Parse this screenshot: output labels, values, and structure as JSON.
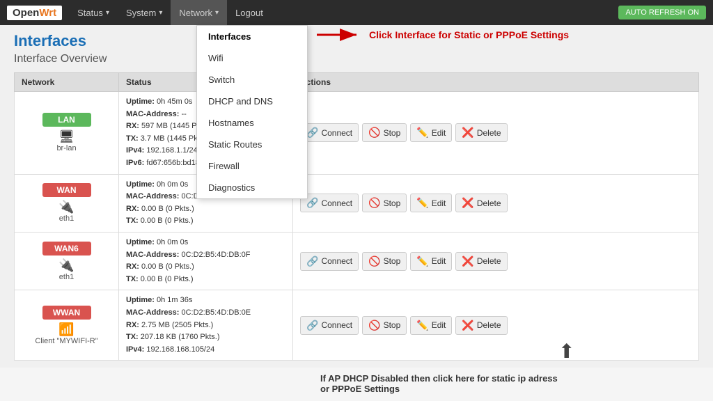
{
  "navbar": {
    "brand": "OpenWrt",
    "items": [
      {
        "label": "Status",
        "has_arrow": true
      },
      {
        "label": "System",
        "has_arrow": true
      },
      {
        "label": "Network",
        "has_arrow": true,
        "active": true
      },
      {
        "label": "Logout",
        "has_arrow": false
      }
    ],
    "auto_refresh_label": "AUTO REFRESH ON"
  },
  "dropdown": {
    "items": [
      {
        "label": "Interfaces",
        "active": true
      },
      {
        "label": "Wifi",
        "active": false
      },
      {
        "label": "Switch",
        "active": false
      },
      {
        "label": "DHCP and DNS",
        "active": false
      },
      {
        "label": "Hostnames",
        "active": false
      },
      {
        "label": "Static Routes",
        "active": false
      },
      {
        "label": "Firewall",
        "active": false
      },
      {
        "label": "Diagnostics",
        "active": false
      }
    ]
  },
  "annotation": {
    "header_text": "Click Interface for Static or PPPoE Settings",
    "bottom_text": "If AP DHCP Disabled then click here for static ip adress or PPPoE Settings"
  },
  "page": {
    "title": "Interfaces",
    "subtitle": "Interface Overview"
  },
  "table": {
    "headers": [
      "Network",
      "Status",
      "Actions"
    ],
    "rows": [
      {
        "name": "LAN",
        "badge_class": "green",
        "icon": "🖥",
        "device": "br-lan",
        "status": "Uptime: 0h 45m 0s\nMAC-Address: --\nRX: 597 MB (1445 Pkts.)\nTX: 3.7 MB (1445 Pkts.)\nIPv4: 192.168.1.1/24\nIPv6: fd67:656b:bd18::1/60",
        "status_lines": [
          {
            "bold": "Uptime:",
            "text": " 0h 45m 0s"
          },
          {
            "bold": "MAC-Address:",
            "text": " --"
          },
          {
            "bold": "RX:",
            "text": " 597 MB (1445 Pkts.)"
          },
          {
            "bold": "TX:",
            "text": " 3.7 MB (1445 Pkts.)"
          },
          {
            "bold": "IPv4:",
            "text": " 192.168.1.1/24"
          },
          {
            "bold": "IPv6:",
            "text": " fd67:656b:bd18::1/60"
          }
        ]
      },
      {
        "name": "WAN",
        "badge_class": "red",
        "icon": "🔌",
        "device": "eth1",
        "status_lines": [
          {
            "bold": "Uptime:",
            "text": " 0h 0m 0s"
          },
          {
            "bold": "MAC-Address:",
            "text": " 0C:D2:B5:4D:DB:0F"
          },
          {
            "bold": "RX:",
            "text": " 0.00 B (0 Pkts.)"
          },
          {
            "bold": "TX:",
            "text": " 0.00 B (0 Pkts.)"
          }
        ]
      },
      {
        "name": "WAN6",
        "badge_class": "red",
        "icon": "🔌",
        "device": "eth1",
        "status_lines": [
          {
            "bold": "Uptime:",
            "text": " 0h 0m 0s"
          },
          {
            "bold": "MAC-Address:",
            "text": " 0C:D2:B5:4D:DB:0F"
          },
          {
            "bold": "RX:",
            "text": " 0.00 B (0 Pkts.)"
          },
          {
            "bold": "TX:",
            "text": " 0.00 B (0 Pkts.)"
          }
        ]
      },
      {
        "name": "WWAN",
        "badge_class": "red",
        "icon": "📶",
        "device": "Client \"MYWIFI-R\"",
        "status_lines": [
          {
            "bold": "Uptime:",
            "text": " 0h 1m 36s"
          },
          {
            "bold": "MAC-Address:",
            "text": " 0C:D2:B5:4D:DB:0E"
          },
          {
            "bold": "RX:",
            "text": " 2.75 MB (2505 Pkts.)"
          },
          {
            "bold": "TX:",
            "text": " 207.18 KB (1760 Pkts.)"
          },
          {
            "bold": "IPv4:",
            "text": " 192.168.168.105/24"
          }
        ]
      }
    ],
    "action_buttons": [
      {
        "label": "Connect",
        "icon": "🔗"
      },
      {
        "label": "Stop",
        "icon": "🚫"
      },
      {
        "label": "Edit",
        "icon": "✏️"
      },
      {
        "label": "Delete",
        "icon": "❌"
      }
    ]
  }
}
